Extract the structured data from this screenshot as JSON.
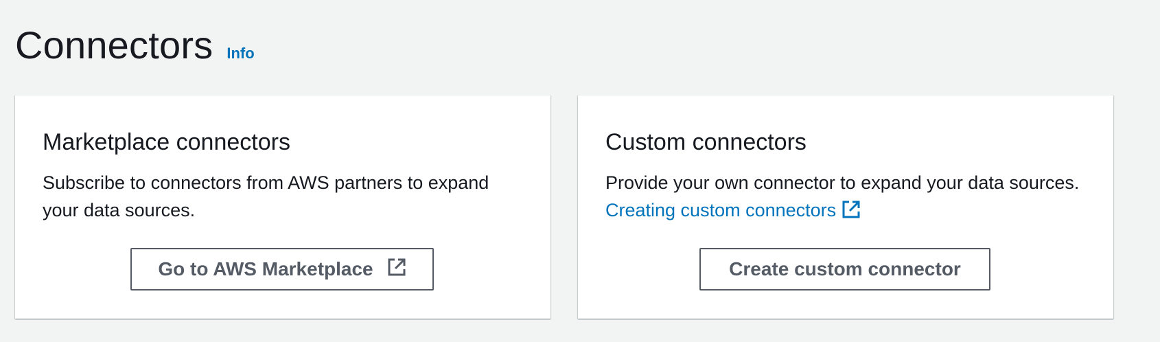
{
  "header": {
    "title": "Connectors",
    "info_label": "Info"
  },
  "cards": {
    "marketplace": {
      "title": "Marketplace connectors",
      "description": "Subscribe to connectors from AWS partners to expand your data sources.",
      "button_label": "Go to AWS Marketplace",
      "button_icon": "external-link-icon"
    },
    "custom": {
      "title": "Custom connectors",
      "description": "Provide your own connector to expand your data sources.",
      "link_label": "Creating custom connectors",
      "link_icon": "external-link-icon",
      "button_label": "Create custom connector"
    }
  },
  "colors": {
    "background": "#f2f3f3",
    "card": "#ffffff",
    "text": "#16191f",
    "link": "#0073bb",
    "button_border": "#545b64"
  }
}
